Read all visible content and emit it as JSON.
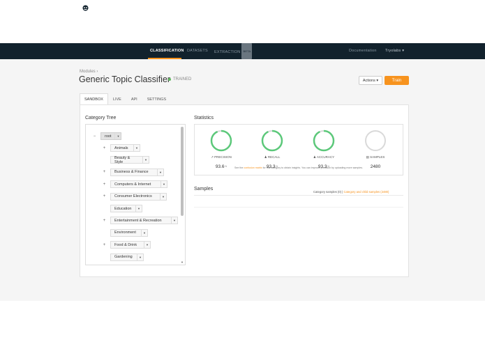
{
  "navbar": {
    "logo_text": "MonkeyLearn",
    "items": [
      "CLASSIFICATION",
      "DATASETS",
      "EXTRACTION"
    ],
    "beta_badge": "BETA",
    "documentation": "Documentation",
    "user": "Tryolabs ▾"
  },
  "breadcrumb": "Modules ›",
  "title": "Generic Topic Classifier",
  "status": "TRAINED",
  "actions_label": "Actions ▾",
  "train_label": "Train",
  "tabs": [
    "SANDBOX",
    "LIVE",
    "API",
    "SETTINGS"
  ],
  "category_tree": {
    "title": "Category Tree",
    "root": "root",
    "nodes": [
      {
        "label": "Animals",
        "expandable": true
      },
      {
        "label": "Beauty & Style",
        "expandable": false
      },
      {
        "label": "Business & Finance",
        "expandable": true
      },
      {
        "label": "Computers & Internet",
        "expandable": true
      },
      {
        "label": "Consumer Electronics",
        "expandable": true
      },
      {
        "label": "Education",
        "expandable": false
      },
      {
        "label": "Entertainment & Recreation",
        "expandable": true
      },
      {
        "label": "Environment",
        "expandable": false
      },
      {
        "label": "Food & Drink",
        "expandable": true
      },
      {
        "label": "Gardening",
        "expandable": false
      }
    ]
  },
  "statistics": {
    "title": "Statistics",
    "metrics": [
      {
        "label": "PRECISION",
        "value": "93.6",
        "unit": "%",
        "fraction": 0.936,
        "icon": "chart-icon"
      },
      {
        "label": "RECALL",
        "value": "93.3",
        "unit": "%",
        "fraction": 0.933,
        "icon": "user-icon"
      },
      {
        "label": "ACCURACY",
        "value": "93.3",
        "unit": "%",
        "fraction": 0.933,
        "icon": "user-icon"
      },
      {
        "label": "SAMPLES",
        "value": "2480",
        "unit": "",
        "fraction": 0,
        "icon": "document-icon"
      }
    ],
    "note_before": "See the",
    "note_link": "confusion matrix",
    "note_after": "for this category to obtain insights. You can improve precision by uploading more samples."
  },
  "samples": {
    "title": "Samples",
    "category_samples": "Category samples (0)",
    "separator": "|",
    "child_samples": "Category and child samples (2480)"
  },
  "colors": {
    "navbar": "#12222d",
    "accent": "#f7931e",
    "gauge_green": "#5cc87a",
    "gauge_gray": "#d9d9d9"
  }
}
